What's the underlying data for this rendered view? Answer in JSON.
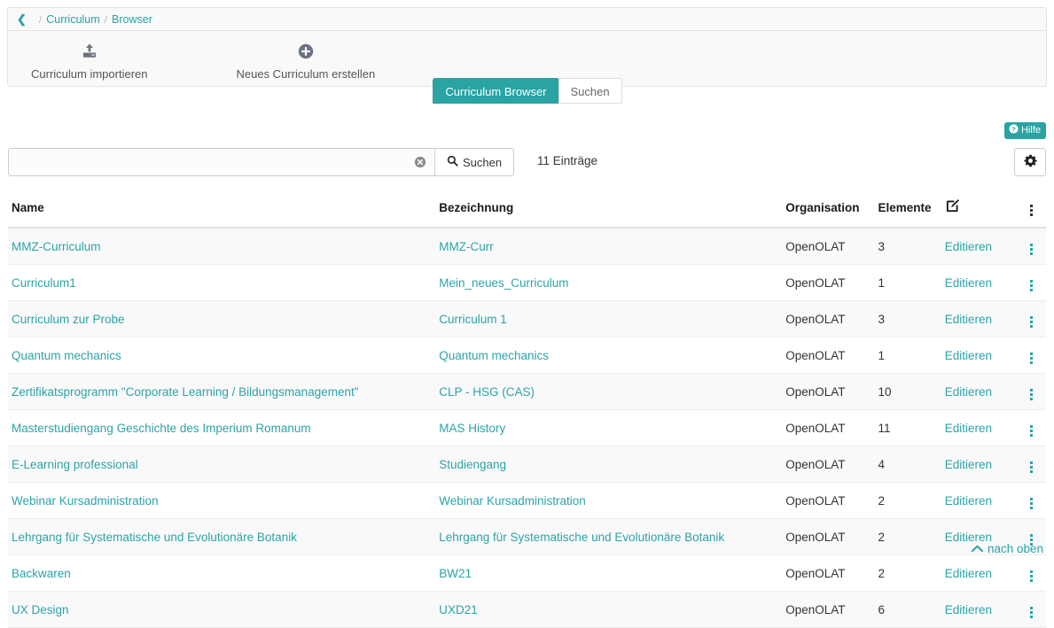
{
  "breadcrumb": {
    "back_icon": "chevron-left-icon",
    "items": [
      "Curriculum",
      "Browser"
    ],
    "separator": "/"
  },
  "toolbar": {
    "buttons": [
      {
        "label": "Curriculum importieren",
        "icon": "upload-icon"
      },
      {
        "label": "Neues Curriculum erstellen",
        "icon": "plus-circle-icon"
      }
    ]
  },
  "tabs": [
    {
      "label": "Curriculum Browser",
      "active": true
    },
    {
      "label": "Suchen",
      "active": false
    }
  ],
  "help": {
    "label": "Hilfe",
    "icon": "question-circle-icon"
  },
  "search": {
    "value": "",
    "placeholder": "",
    "clear_icon": "clear-circle-icon",
    "button_label": "Suchen",
    "button_icon": "search-icon",
    "entries_label": "11 Einträge",
    "settings_icon": "gear-icon"
  },
  "table": {
    "headers": {
      "name": "Name",
      "bezeichnung": "Bezeichnung",
      "organisation": "Organisation",
      "elemente": "Elemente",
      "edit_icon": "pencil-square-icon",
      "menu_icon": "vertical-dots-icon"
    },
    "edit_label": "Editieren",
    "rows": [
      {
        "name": "MMZ-Curriculum",
        "bezeichnung": "MMZ-Curr",
        "organisation": "OpenOLAT",
        "elemente": "3",
        "edit": "Editieren"
      },
      {
        "name": "Curriculum1",
        "bezeichnung": "Mein_neues_Curriculum",
        "organisation": "OpenOLAT",
        "elemente": "1",
        "edit": "Editieren"
      },
      {
        "name": "Curriculum zur Probe",
        "bezeichnung": "Curriculum 1",
        "organisation": "OpenOLAT",
        "elemente": "3",
        "edit": "Editieren"
      },
      {
        "name": "Quantum mechanics",
        "bezeichnung": "Quantum mechanics",
        "organisation": "OpenOLAT",
        "elemente": "1",
        "edit": "Editieren"
      },
      {
        "name": "Zertifikatsprogramm \"Corporate Learning / Bildungsmanagement\"",
        "bezeichnung": "CLP - HSG (CAS)",
        "organisation": "OpenOLAT",
        "elemente": "10",
        "edit": "Editieren"
      },
      {
        "name": "Masterstudiengang Geschichte des Imperium Romanum",
        "bezeichnung": "MAS History",
        "organisation": "OpenOLAT",
        "elemente": "11",
        "edit": "Editieren"
      },
      {
        "name": "E-Learning professional",
        "bezeichnung": "Studiengang",
        "organisation": "OpenOLAT",
        "elemente": "4",
        "edit": "Editieren"
      },
      {
        "name": "Webinar Kursadministration",
        "bezeichnung": "Webinar Kursadministration",
        "organisation": "OpenOLAT",
        "elemente": "2",
        "edit": "Editieren"
      },
      {
        "name": "Lehrgang für Systematische und Evolutionäre Botanik",
        "bezeichnung": "Lehrgang für Systematische und Evolutionäre Botanik",
        "organisation": "OpenOLAT",
        "elemente": "2",
        "edit": "Editieren"
      },
      {
        "name": "Backwaren",
        "bezeichnung": "BW21",
        "organisation": "OpenOLAT",
        "elemente": "2",
        "edit": "Editieren"
      },
      {
        "name": "UX Design",
        "bezeichnung": "UXD21",
        "organisation": "OpenOLAT",
        "elemente": "6",
        "edit": "Editieren"
      }
    ]
  },
  "footer": {
    "back_to_top": "nach oben",
    "back_to_top_icon": "chevron-up-icon"
  },
  "colors": {
    "accent": "#2aa3a3",
    "link": "#2ca3a8",
    "panel_bg": "#f9f9f9",
    "border": "#e3e3e3",
    "row_alt": "#f9f9f9"
  }
}
